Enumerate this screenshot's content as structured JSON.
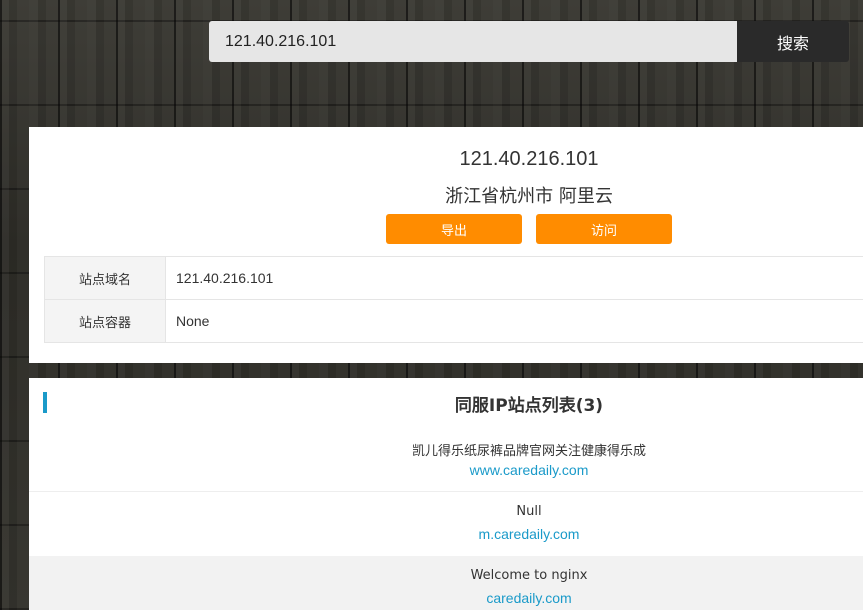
{
  "search": {
    "value": "121.40.216.101",
    "button_label": "搜索"
  },
  "info": {
    "ip": "121.40.216.101",
    "location": "浙江省杭州市 阿里云",
    "export_label": "导出",
    "visit_label": "访问",
    "rows": [
      {
        "key": "站点域名",
        "value": "121.40.216.101"
      },
      {
        "key": "站点容器",
        "value": "None"
      }
    ]
  },
  "site_list": {
    "title": "同服IP站点列表(3)",
    "items": [
      {
        "title": "凯儿得乐纸尿裤品牌官网关注健康得乐成",
        "domain": "www.caredaily.com"
      },
      {
        "title": "Null",
        "domain": "m.caredaily.com"
      },
      {
        "title": "Welcome to nginx",
        "domain": "caredaily.com"
      }
    ]
  },
  "colors": {
    "accent_orange": "#ff8c00",
    "link_blue": "#1a9ac9",
    "search_button": "#2a2a2a"
  }
}
